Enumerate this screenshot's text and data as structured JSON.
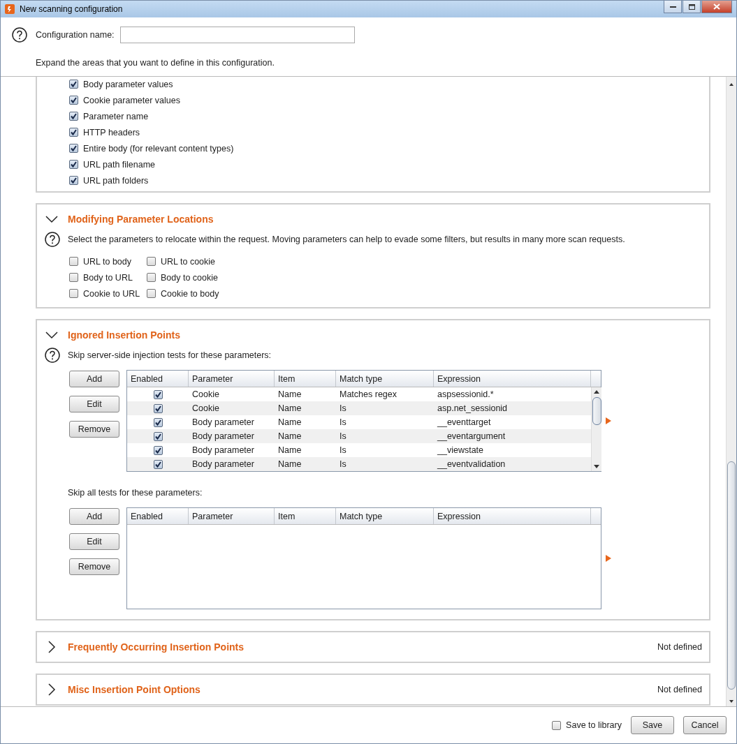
{
  "window": {
    "title": "New scanning configuration"
  },
  "header": {
    "name_label": "Configuration name:",
    "intro": "Expand the areas that you want to define in this configuration."
  },
  "sections": [
    {
      "kind": "checklist",
      "items": [
        {
          "label": "Body parameter values",
          "checked": true
        },
        {
          "label": "Cookie parameter values",
          "checked": true
        },
        {
          "label": "Parameter name",
          "checked": true
        },
        {
          "label": "HTTP headers",
          "checked": true
        },
        {
          "label": "Entire body (for relevant content types)",
          "checked": true
        },
        {
          "label": "URL path filename",
          "checked": true
        },
        {
          "label": "URL path folders",
          "checked": true
        }
      ]
    },
    {
      "kind": "locations",
      "title": "Modifying Parameter Locations",
      "expanded": true,
      "description": "Select the parameters to relocate within the request. Moving parameters can help to evade some filters, but results in many more scan requests.",
      "options": [
        {
          "label": "URL to body",
          "checked": false
        },
        {
          "label": "URL to cookie",
          "checked": false
        },
        {
          "label": "Body to URL",
          "checked": false
        },
        {
          "label": "Body to cookie",
          "checked": false
        },
        {
          "label": "Cookie to URL",
          "checked": false
        },
        {
          "label": "Cookie to body",
          "checked": false
        }
      ]
    },
    {
      "kind": "tables",
      "title": "Ignored Insertion Points",
      "expanded": true,
      "groups": [
        {
          "caption": "Skip server-side injection tests for these parameters:",
          "help": true,
          "buttons": [
            "Add",
            "Edit",
            "Remove"
          ],
          "columns": [
            "Enabled",
            "Parameter",
            "Item",
            "Match type",
            "Expression"
          ],
          "rows": [
            {
              "enabled": true,
              "cells": [
                "",
                "Cookie",
                "Name",
                "Matches regex",
                "aspsessionid.*"
              ]
            },
            {
              "enabled": true,
              "cells": [
                "",
                "Cookie",
                "Name",
                "Is",
                "asp.net_sessionid"
              ]
            },
            {
              "enabled": true,
              "cells": [
                "",
                "Body parameter",
                "Name",
                "Is",
                "__eventtarget"
              ]
            },
            {
              "enabled": true,
              "cells": [
                "",
                "Body parameter",
                "Name",
                "Is",
                "__eventargument"
              ]
            },
            {
              "enabled": true,
              "cells": [
                "",
                "Body parameter",
                "Name",
                "Is",
                "__viewstate"
              ]
            },
            {
              "enabled": true,
              "cells": [
                "",
                "Body parameter",
                "Name",
                "Is",
                "__eventvalidation"
              ]
            }
          ]
        },
        {
          "caption": "Skip all tests for these parameters:",
          "help": false,
          "buttons": [
            "Add",
            "Edit",
            "Remove"
          ],
          "columns": [
            "Enabled",
            "Parameter",
            "Item",
            "Match type",
            "Expression"
          ]
        }
      ]
    },
    {
      "kind": "collapsed",
      "title": "Frequently Occurring Insertion Points",
      "expanded": false,
      "status": "Not defined"
    },
    {
      "kind": "collapsed",
      "title": "Misc Insertion Point Options",
      "expanded": false,
      "status": "Not defined"
    }
  ],
  "footer": {
    "save_to_library": {
      "label": "Save to library",
      "checked": false
    },
    "buttons": [
      "Save",
      "Cancel"
    ]
  }
}
